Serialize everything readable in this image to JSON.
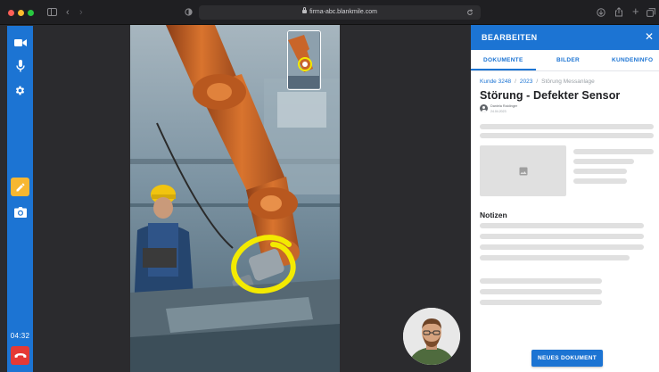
{
  "browser": {
    "url": "firma-abc.blankmile.com"
  },
  "call": {
    "duration": "04:32",
    "colors": {
      "toolbar": "#1c74d3",
      "pen_active": "#f7b731",
      "hangup": "#e53935",
      "annotation": "#f3ea00"
    }
  },
  "panel": {
    "title": "BEARBEITEN",
    "close_label": "✕",
    "tabs": [
      {
        "label": "DOKUMENTE",
        "active": true
      },
      {
        "label": "BILDER",
        "active": false
      },
      {
        "label": "KUNDENINFO",
        "active": false
      }
    ],
    "breadcrumb": [
      "Kunde 3248",
      "2023",
      "Störung Messanlage"
    ],
    "document_title": "Störung - Defekter Sensor",
    "author_name": "Daniela Raidinger",
    "author_date": "24.04.2023",
    "notes_heading": "Notizen",
    "new_document_label": "NEUES DOKUMENT"
  },
  "icons": {
    "toolbar": [
      "video-camera-icon",
      "microphone-icon",
      "settings-gear-icon",
      "pen-icon",
      "photo-camera-icon",
      "phone-hangup-icon"
    ],
    "chrome": [
      "sidebar-icon",
      "back-icon",
      "forward-icon",
      "privacy-icon",
      "lock-icon",
      "reload-icon",
      "download-icon",
      "share-icon",
      "new-tab-icon",
      "tabs-icon"
    ]
  }
}
